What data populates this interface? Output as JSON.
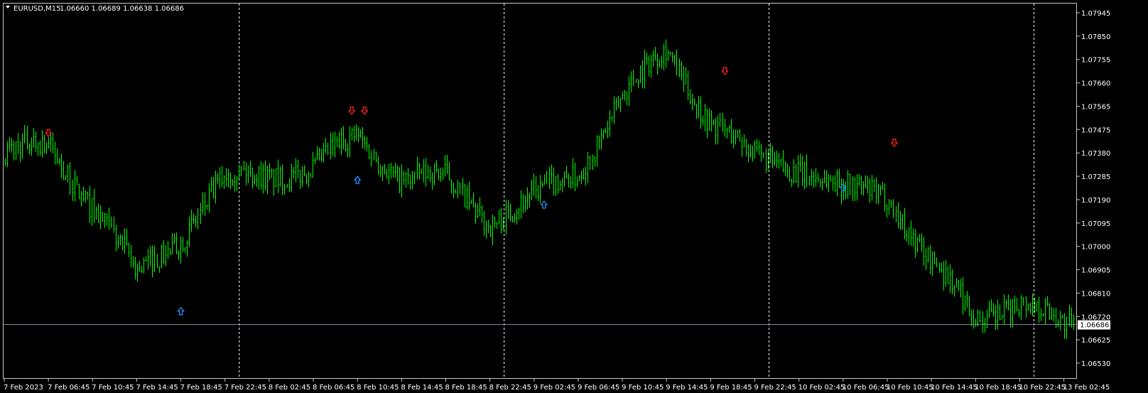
{
  "header": {
    "symbol_label": "EURUSD,M15",
    "ohlc_text": "1.06660 1.06689 1.06638 1.06686"
  },
  "price_label": "1.06686",
  "colors": {
    "background": "#000000",
    "candle": "#00ff00",
    "grid": "#ffffff",
    "bid_line": "#7f8fa6",
    "sell_arrow": "#ff2020",
    "buy_arrow": "#1e90ff",
    "axis_text": "#ffffff"
  },
  "chart_data": {
    "type": "candlestick",
    "symbol": "EURUSD",
    "timeframe": "M15",
    "ylim": [
      1.0653,
      1.0794
    ],
    "y_ticks": [
      "1.07945",
      "1.07850",
      "1.07755",
      "1.07660",
      "1.07565",
      "1.07475",
      "1.07380",
      "1.07285",
      "1.07190",
      "1.07095",
      "1.07000",
      "1.06905",
      "1.06810",
      "1.06720",
      "1.06625",
      "1.06530"
    ],
    "x_tick_labels": [
      "7 Feb 2023",
      "7 Feb 06:45",
      "7 Feb 10:45",
      "7 Feb 14:45",
      "7 Feb 18:45",
      "7 Feb 22:45",
      "8 Feb 02:45",
      "8 Feb 06:45",
      "8 Feb 10:45",
      "8 Feb 14:45",
      "8 Feb 18:45",
      "8 Feb 22:45",
      "9 Feb 02:45",
      "9 Feb 06:45",
      "9 Feb 10:45",
      "9 Feb 14:45",
      "9 Feb 18:45",
      "9 Feb 22:45",
      "10 Feb 02:45",
      "10 Feb 06:45",
      "10 Feb 10:45",
      "10 Feb 14:45",
      "10 Feb 18:45",
      "10 Feb 22:45",
      "13 Feb 02:45"
    ],
    "day_separators": [
      "7 Feb 22:45",
      "8 Feb 22:45",
      "9 Feb 22:45",
      "10 Feb 22:45"
    ],
    "grid": false,
    "bid_price": 1.06686,
    "last_candle": {
      "open": 1.0666,
      "high": 1.06689,
      "low": 1.06638,
      "close": 1.06686
    },
    "price_path": [
      {
        "t": "7 Feb 2023",
        "price": 1.0737
      },
      {
        "t": "7 Feb 06:45",
        "price": 1.0741
      },
      {
        "t": "7 Feb 10:45",
        "price": 1.0717
      },
      {
        "t": "7 Feb 14:45",
        "price": 1.0688
      },
      {
        "t": "7 Feb 18:45",
        "price": 1.0705
      },
      {
        "t": "7 Feb 22:45",
        "price": 1.0727
      },
      {
        "t": "8 Feb 02:45",
        "price": 1.073
      },
      {
        "t": "8 Feb 06:45",
        "price": 1.0731
      },
      {
        "t": "8 Feb 10:45",
        "price": 1.0745
      },
      {
        "t": "8 Feb 14:45",
        "price": 1.0728
      },
      {
        "t": "8 Feb 18:45",
        "price": 1.0727
      },
      {
        "t": "8 Feb 22:45",
        "price": 1.0711
      },
      {
        "t": "9 Feb 02:45",
        "price": 1.0719
      },
      {
        "t": "9 Feb 06:45",
        "price": 1.0731
      },
      {
        "t": "9 Feb 10:45",
        "price": 1.076
      },
      {
        "t": "9 Feb 14:45",
        "price": 1.078
      },
      {
        "t": "9 Feb 18:45",
        "price": 1.0751
      },
      {
        "t": "9 Feb 22:45",
        "price": 1.0735
      },
      {
        "t": "10 Feb 02:45",
        "price": 1.0733
      },
      {
        "t": "10 Feb 06:45",
        "price": 1.0722
      },
      {
        "t": "10 Feb 10:45",
        "price": 1.0722
      },
      {
        "t": "10 Feb 14:45",
        "price": 1.0693
      },
      {
        "t": "10 Feb 18:45",
        "price": 1.0671
      },
      {
        "t": "10 Feb 22:45",
        "price": 1.0679
      },
      {
        "t": "13 Feb 02:45",
        "price": 1.0667
      }
    ],
    "arrows": [
      {
        "type": "sell",
        "t": "7 Feb 06:45",
        "price": 1.0746
      },
      {
        "type": "buy",
        "t": "7 Feb 18:45",
        "price": 1.0674
      },
      {
        "type": "sell",
        "t": "8 Feb 10:45",
        "price": 1.0755
      },
      {
        "type": "sell",
        "t": "8 Feb 10:45",
        "price": 1.0755
      },
      {
        "type": "buy",
        "t": "8 Feb 10:45",
        "price": 1.0727
      },
      {
        "type": "buy",
        "t": "9 Feb 02:45",
        "price": 1.0717
      },
      {
        "type": "sell",
        "t": "9 Feb 18:45",
        "price": 1.0771
      },
      {
        "type": "buy",
        "t": "10 Feb 06:45",
        "price": 1.0724
      },
      {
        "type": "sell",
        "t": "10 Feb 10:45",
        "price": 1.0742
      }
    ]
  }
}
